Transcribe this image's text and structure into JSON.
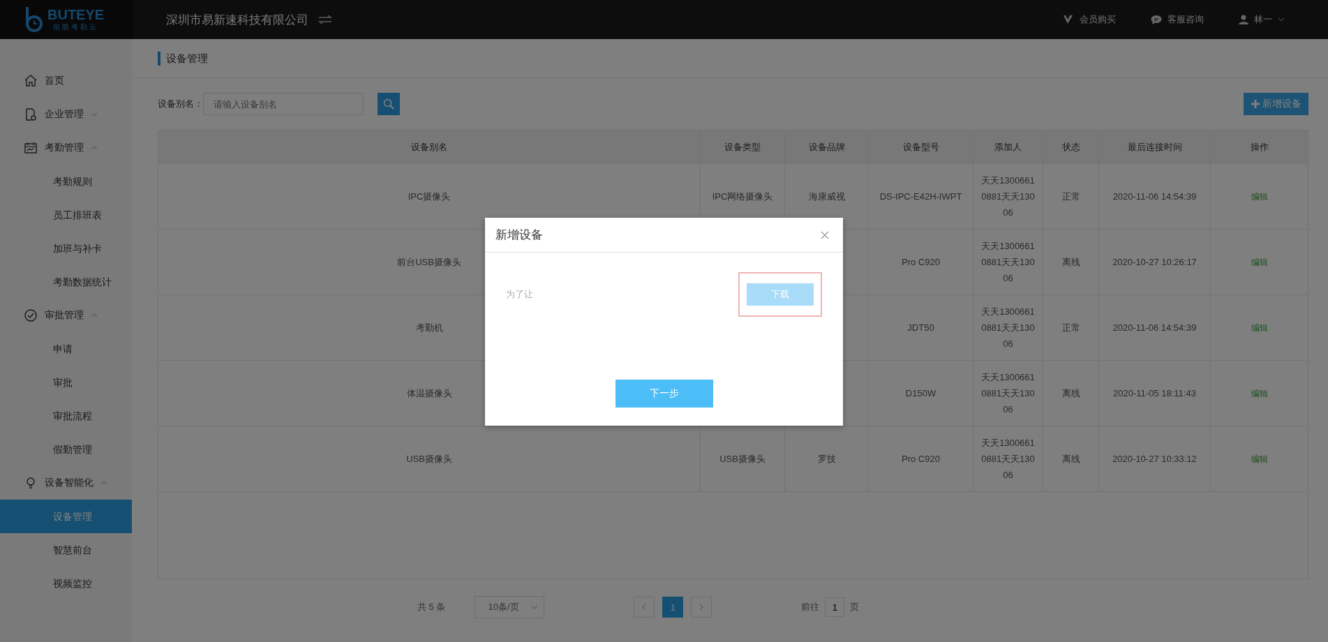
{
  "header": {
    "logo": {
      "name": "BUTEYE",
      "tagline": "佰眼考勤云"
    },
    "company": "深圳市易新速科技有限公司",
    "links": [
      {
        "kind": "vip",
        "label": "会员购买"
      },
      {
        "kind": "chat",
        "label": "客服咨询"
      },
      {
        "kind": "user",
        "label": "林一"
      }
    ]
  },
  "sidebar": {
    "items": [
      {
        "label": "首页"
      },
      {
        "label": "企业管理",
        "expanded": false
      },
      {
        "label": "考勤管理",
        "expanded": true,
        "children": [
          {
            "label": "考勤规则",
            "selected": false
          },
          {
            "label": "员工排班表",
            "selected": false
          },
          {
            "label": "加班与补卡",
            "selected": false
          },
          {
            "label": "考勤数据统计",
            "selected": false
          }
        ]
      },
      {
        "label": "审批管理",
        "expanded": true,
        "children": [
          {
            "label": "申请",
            "selected": false
          },
          {
            "label": "审批",
            "selected": false
          },
          {
            "label": "审批流程",
            "selected": false
          },
          {
            "label": "假勤管理",
            "selected": false
          }
        ]
      },
      {
        "label": "设备智能化",
        "expanded": true,
        "children": [
          {
            "label": "设备管理",
            "selected": true
          },
          {
            "label": "智慧前台",
            "selected": false
          },
          {
            "label": "视频监控",
            "selected": false
          }
        ]
      }
    ]
  },
  "page_title": "设备管理",
  "search": {
    "label": "设备别名：",
    "placeholder": "请输入设备别名"
  },
  "add_button": "新增设备",
  "table": {
    "columns": [
      "设备别名",
      "设备类型",
      "设备品牌",
      "设备型号",
      "添加人",
      "状态",
      "最后连接时间",
      "操作"
    ],
    "rows": [
      {
        "cells": [
          "IPC摄像头",
          "IPC网络摄像头",
          "海康威视",
          "DS-IPC-E42H-IWPT",
          "天天13006610881天天13006",
          "正常",
          "2020-11-06 14:54:39",
          "编辑"
        ]
      },
      {
        "cells": [
          "前台USB摄像头",
          null,
          null,
          "Pro C920",
          "天天13006610881天天13006",
          "离线",
          "2020-10-27 10:26:17",
          "编辑"
        ]
      },
      {
        "cells": [
          "考勤机",
          null,
          null,
          "JDT50",
          "天天13006610881天天13006",
          "正常",
          "2020-11-06 14:54:39",
          "编辑"
        ]
      },
      {
        "cells": [
          "体温摄像头",
          null,
          null,
          "D150W",
          "天天13006610881天天13006",
          "离线",
          "2020-11-05 18:11:43",
          "编辑"
        ]
      },
      {
        "cells": [
          "USB摄像头",
          "USB摄像头",
          "罗技",
          "Pro C920",
          "天天13006610881天天13006",
          "离线",
          "2020-10-27 10:33:12",
          "编辑"
        ]
      }
    ]
  },
  "pagination": {
    "total": "共 5 条",
    "page_size": "10条/页",
    "pages": [
      {
        "label": "1",
        "selected": true
      }
    ],
    "goto_label": "前往",
    "goto_value": "1",
    "goto_suffix": "页"
  },
  "dialog": {
    "title": "新增设备",
    "text": "为了让",
    "download_button": "下载",
    "next_button": "下一步"
  }
}
